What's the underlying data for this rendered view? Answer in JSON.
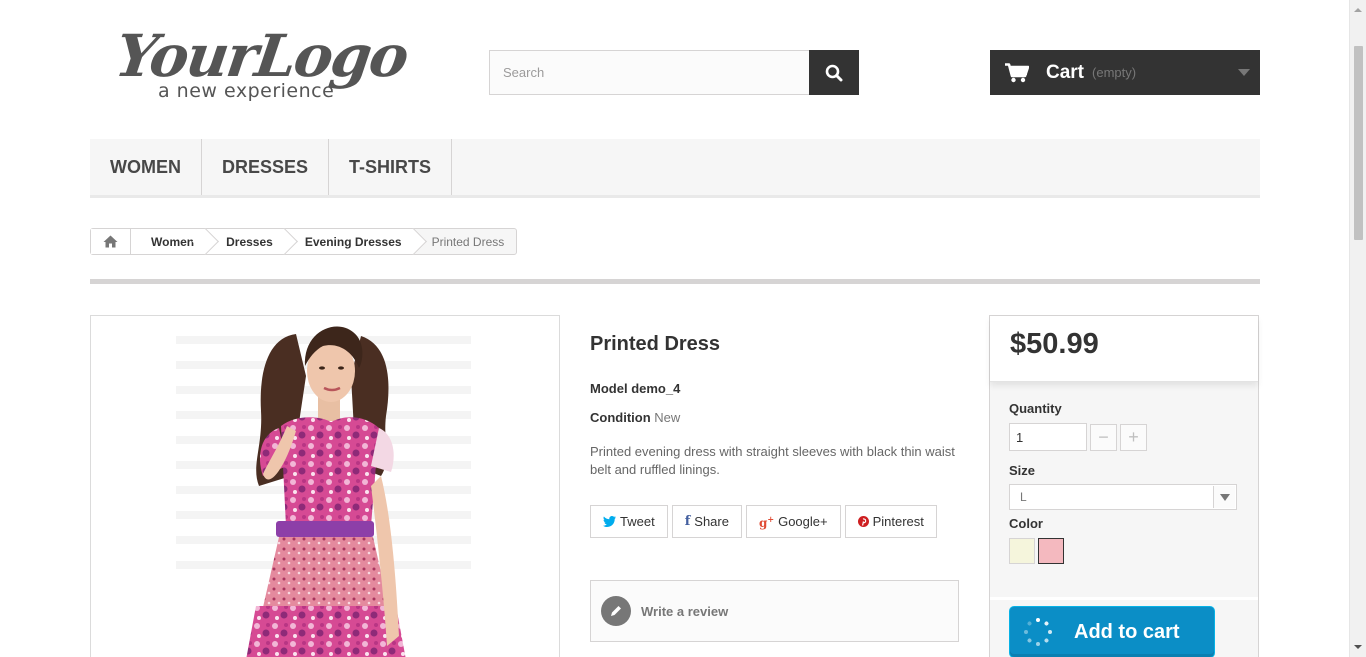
{
  "header": {
    "logo_main": "YourLogo",
    "logo_tagline": "a new experience",
    "search_placeholder": "Search",
    "cart_label": "Cart",
    "cart_status": "(empty)"
  },
  "menu": {
    "items": [
      {
        "label": "Women"
      },
      {
        "label": "Dresses"
      },
      {
        "label": "T-shirts"
      }
    ]
  },
  "breadcrumb": {
    "items": [
      "Women",
      "Dresses",
      "Evening Dresses"
    ],
    "current": "Printed Dress"
  },
  "product": {
    "title": "Printed Dress",
    "model_label": "Model",
    "model_value": "demo_4",
    "condition_label": "Condition",
    "condition_value": "New",
    "description": "Printed evening dress with straight sleeves with black thin waist belt and ruffled linings."
  },
  "social": {
    "tweet": "Tweet",
    "share": "Share",
    "google": "Google+",
    "pinterest": "Pinterest"
  },
  "review": {
    "label": "Write a review"
  },
  "buy": {
    "price": "$50.99",
    "quantity_label": "Quantity",
    "quantity_value": "1",
    "size_label": "Size",
    "size_value": "L",
    "color_label": "Color",
    "colors": [
      "#f5f5dc",
      "#f4b9bf"
    ],
    "selected_color_index": 1,
    "add_to_cart": "Add to cart"
  },
  "colors": {
    "dark": "#333333",
    "accent_blue": "#0b8ec6",
    "twitter": "#00aced",
    "facebook": "#435f9f",
    "google": "#e04b34",
    "pinterest": "#ce1f21"
  }
}
